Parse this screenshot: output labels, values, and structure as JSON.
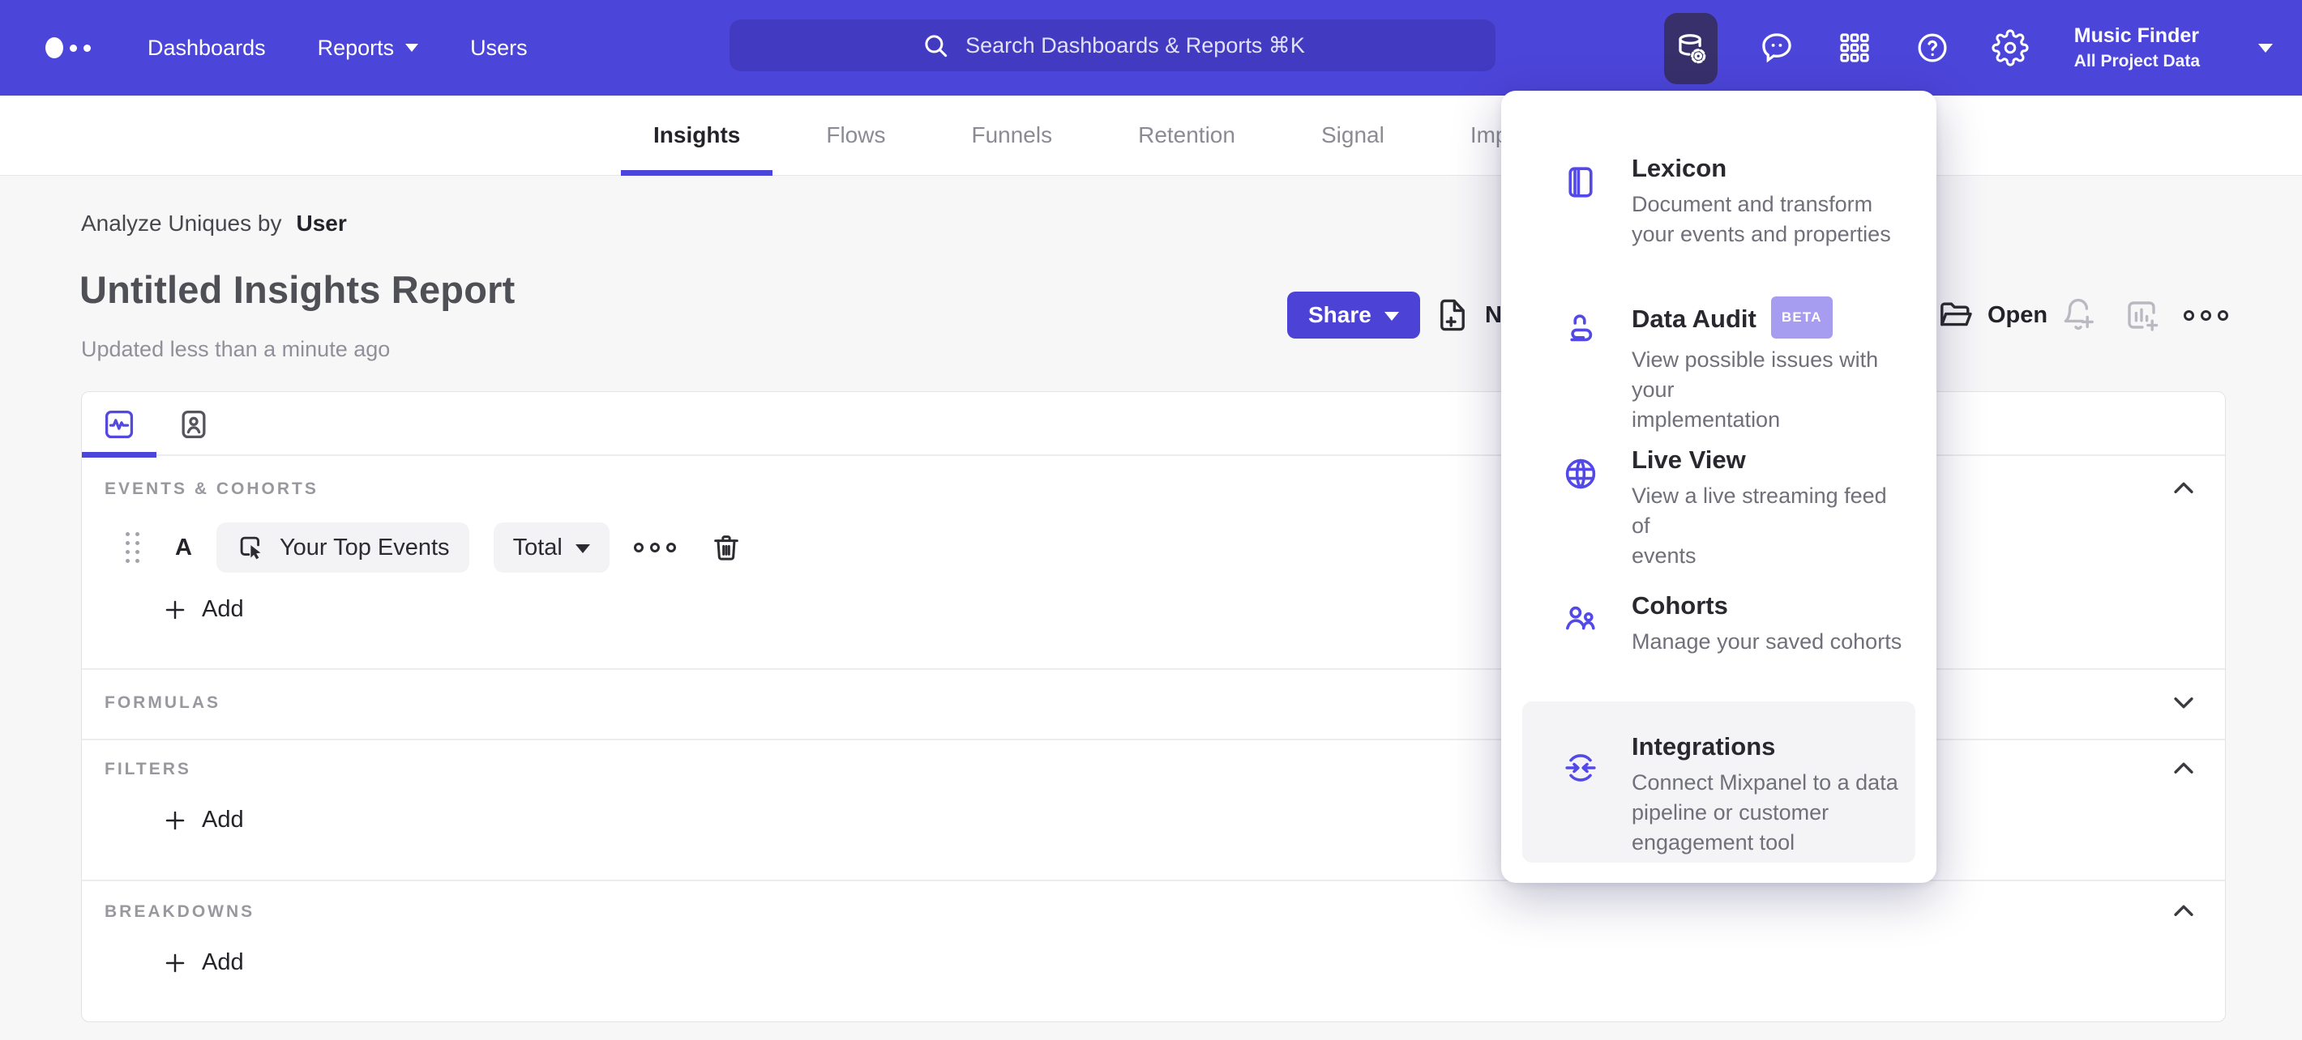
{
  "colors": {
    "nav_bg": "#4c45d9",
    "accent": "#5348e0",
    "active_tile_bg": "#37306b",
    "beta_badge_bg": "#a79df0",
    "page_bg": "#f7f7f8"
  },
  "nav": {
    "links": [
      {
        "label": "Dashboards"
      },
      {
        "label": "Reports"
      },
      {
        "label": "Users"
      }
    ],
    "search_placeholder": "Search Dashboards & Reports ⌘K",
    "project_name": "Music Finder",
    "project_scope": "All Project Data"
  },
  "tabbar": {
    "tabs": [
      {
        "label": "Insights"
      },
      {
        "label": "Flows"
      },
      {
        "label": "Funnels"
      },
      {
        "label": "Retention"
      },
      {
        "label": "Signal"
      },
      {
        "label": "Impact"
      }
    ],
    "active": "Insights"
  },
  "header": {
    "analyze_prefix": "Analyze Uniques by",
    "analyze_entity": "User",
    "title": "Untitled Insights Report",
    "updated": "Updated less than a minute ago",
    "share": "Share",
    "new": "New",
    "open": "Open"
  },
  "builder": {
    "events_header": "EVENTS & COHORTS",
    "event_row": {
      "letter": "A",
      "event": "Your Top Events",
      "aggregation": "Total"
    },
    "add": "Add",
    "formulas_header": "FORMULAS",
    "filters_header": "FILTERS",
    "breakdowns_header": "BREAKDOWNS"
  },
  "menu": {
    "items": [
      {
        "title": "Lexicon",
        "desc": "Document and transform\nyour events and properties"
      },
      {
        "title": "Data Audit",
        "badge": "BETA",
        "desc": "View possible issues with your\nimplementation"
      },
      {
        "title": "Live View",
        "desc": "View a live streaming feed of\nevents"
      },
      {
        "title": "Cohorts",
        "desc": "Manage your saved cohorts"
      },
      {
        "title": "Integrations",
        "desc": "Connect Mixpanel to a data\npipeline or customer\nengagement tool"
      }
    ]
  }
}
